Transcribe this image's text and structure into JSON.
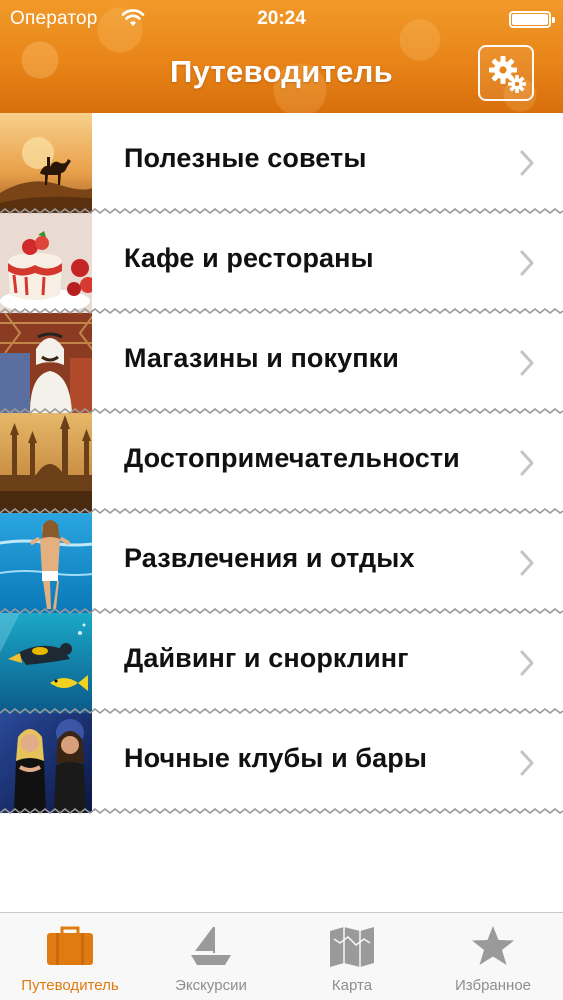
{
  "status_bar": {
    "carrier": "Оператор",
    "time": "20:24",
    "battery_level": 1.0
  },
  "header": {
    "title": "Путеводитель",
    "settings_icon": "gears-icon",
    "color": "#e88418"
  },
  "menu": {
    "items": [
      {
        "label": "Полезные советы",
        "image": "camel-desert-photo"
      },
      {
        "label": "Кафе и рестораны",
        "image": "dessert-strawberry-photo"
      },
      {
        "label": "Магазины и покупки",
        "image": "carpet-seller-photo"
      },
      {
        "label": "Достопримечательности",
        "image": "mosque-skyline-photo"
      },
      {
        "label": "Развлечения и отдых",
        "image": "beach-woman-photo"
      },
      {
        "label": "Дайвинг и снорклинг",
        "image": "diver-underwater-photo"
      },
      {
        "label": "Ночные клубы и бары",
        "image": "nightclub-women-photo"
      }
    ],
    "chevron_icon": "chevron-right-icon"
  },
  "tabbar": {
    "tabs": [
      {
        "label": "Путеводитель",
        "icon": "suitcase-icon",
        "active": true
      },
      {
        "label": "Экскурсии",
        "icon": "sailboat-icon",
        "active": false
      },
      {
        "label": "Карта",
        "icon": "map-icon",
        "active": false
      },
      {
        "label": "Избранное",
        "icon": "star-icon",
        "active": false
      }
    ],
    "active_color": "#e07b12",
    "inactive_color": "#8e8e8e"
  }
}
